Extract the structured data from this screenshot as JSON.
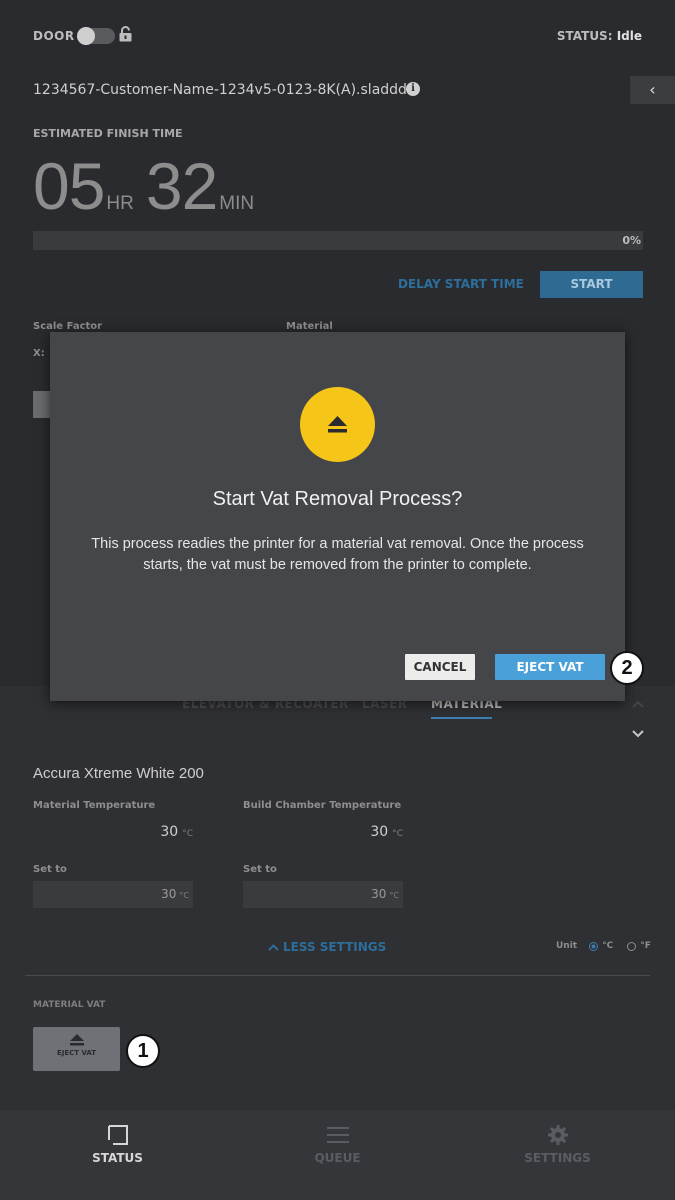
{
  "header": {
    "door_label": "DOOR",
    "status_prefix": "STATUS:",
    "status_value": "Idle"
  },
  "job": {
    "file_name": "1234567-Customer-Name-1234v5-0123-8K(A).sladdd",
    "info_icon": "i",
    "collapse_icon": "‹"
  },
  "finish": {
    "label": "ESTIMATED FINISH TIME",
    "hours": "05",
    "hours_unit": "HR",
    "minutes": "32",
    "minutes_unit": "MIN",
    "progress": 0,
    "progress_text": "0%"
  },
  "actions": {
    "delay_label": "DELAY START TIME",
    "start_label": "START"
  },
  "details": {
    "scale_label": "Scale Factor",
    "material_label": "Material",
    "x_label": "X:"
  },
  "tabs": [
    {
      "label": "ELEVATOR & RECOATER"
    },
    {
      "label": "LASER"
    },
    {
      "label": "MATERIAL"
    }
  ],
  "material": {
    "name": "Accura Xtreme White 200",
    "temp_label": "Material Temperature",
    "temp_value": "30",
    "chamber_label": "Build Chamber Temperature",
    "chamber_value": "30",
    "unit": "°C",
    "set_label": "Set to",
    "set_temp": "30",
    "set_chamber": "30",
    "less_settings": "LESS SETTINGS",
    "unit_label": "Unit",
    "unit_c": "°C",
    "unit_f": "°F"
  },
  "vat": {
    "section_label": "MATERIAL VAT",
    "eject_label": "EJECT VAT"
  },
  "callouts": {
    "one": "1",
    "two": "2"
  },
  "nav": {
    "status": "STATUS",
    "queue": "QUEUE",
    "settings": "SETTINGS"
  },
  "modal": {
    "title": "Start Vat Removal Process?",
    "body": "This process readies the printer for a material vat removal. Once the process starts, the vat must be removed from the printer to complete.",
    "cancel_label": "CANCEL",
    "eject_label": "EJECT VAT"
  },
  "colors": {
    "accent": "#4aa0d8",
    "warning": "#f5c518",
    "background": "#2a2b2e"
  }
}
